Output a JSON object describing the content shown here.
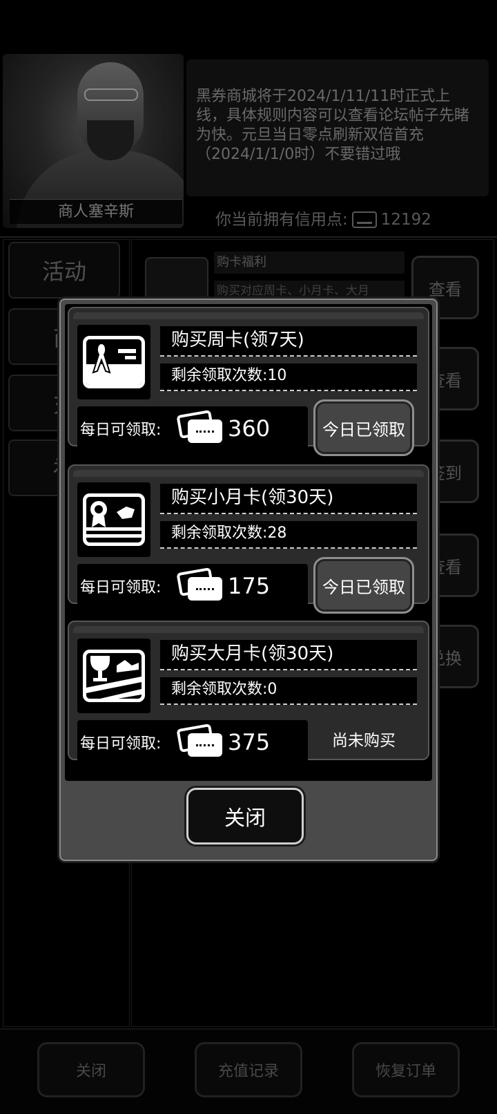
{
  "background": {
    "merchant_name": "商人塞辛斯",
    "notice": "黑券商城将于2024/1/11/11时正式上线，具体规则内容可以查看论坛帖子先睹为快。元旦当日零点刷新双倍首充（2024/1/1/0时）不要错过哦",
    "credit_label": "你当前拥有信用点:",
    "credit_value": "12192",
    "side_tabs": [
      "活动",
      "商",
      "充",
      "福"
    ],
    "list_first_title": "购卡福利",
    "list_first_desc": "购买对应周卡、小月卡、大月",
    "row_buttons": [
      "查看",
      "查看",
      "签到",
      "查看",
      "兑换"
    ],
    "bottom_buttons": [
      "关闭",
      "充值记录",
      "恢复订单"
    ]
  },
  "modal": {
    "cards": [
      {
        "title": "购买周卡(领7天)",
        "remaining": "剩余领取次数:10",
        "daily_label": "每日可领取:",
        "daily_value": "360",
        "status": "今日已领取",
        "icon": "ribbon-card-icon"
      },
      {
        "title": "购买小月卡(领30天)",
        "remaining": "剩余领取次数:28",
        "daily_label": "每日可领取:",
        "daily_value": "175",
        "status": "今日已领取",
        "icon": "medal-card-icon"
      },
      {
        "title": "购买大月卡(领30天)",
        "remaining": "剩余领取次数:0",
        "daily_label": "每日可领取:",
        "daily_value": "375",
        "status": "尚未购买",
        "icon": "trophy-card-icon"
      }
    ],
    "close_label": "关闭"
  },
  "colors": {
    "modal_frame": "#4a4a4a",
    "card_bg": "#2b2b2b",
    "button_bg": "#454545",
    "text": "#ffffff"
  }
}
